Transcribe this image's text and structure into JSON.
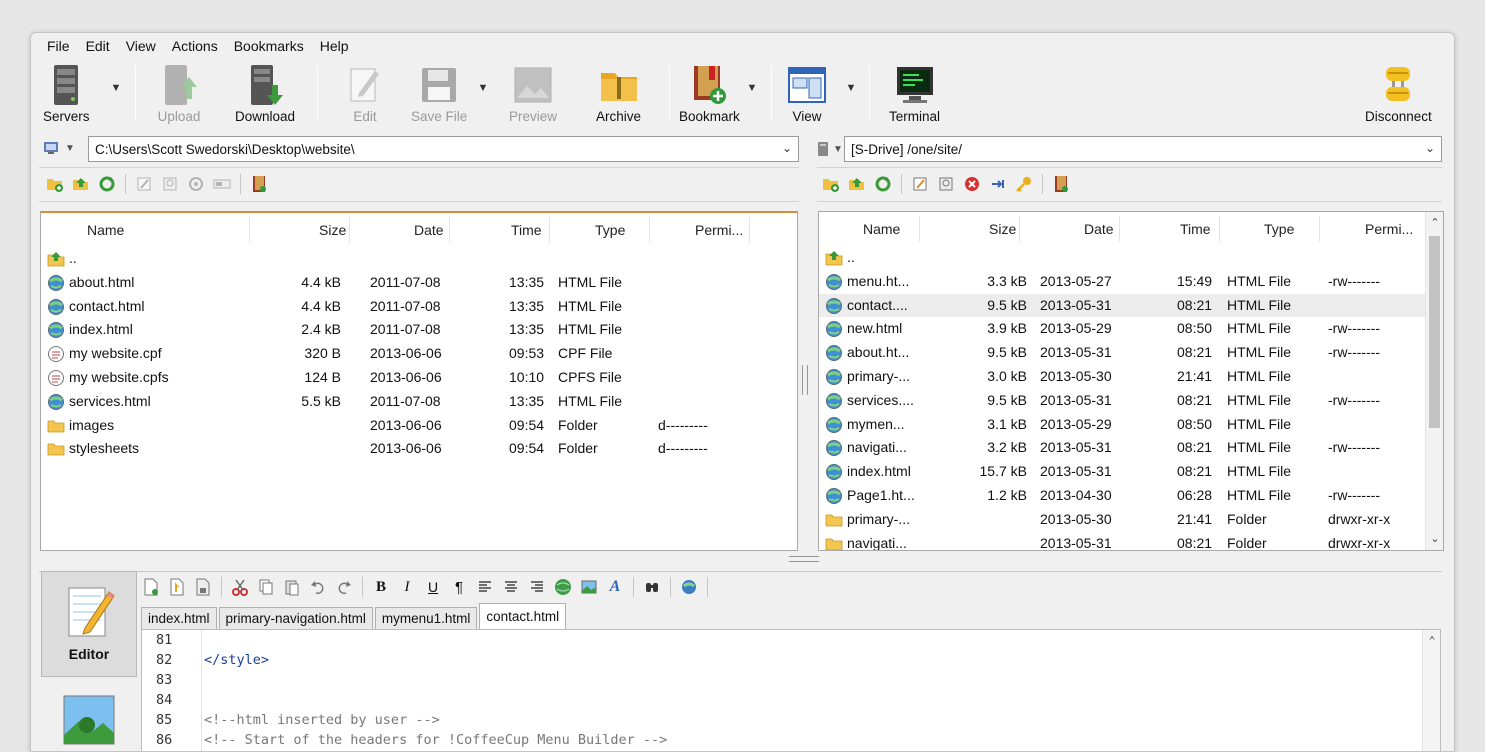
{
  "menu": [
    "File",
    "Edit",
    "View",
    "Actions",
    "Bookmarks",
    "Help"
  ],
  "toolbar": {
    "servers": "Servers",
    "upload": "Upload",
    "download": "Download",
    "edit": "Edit",
    "save_file": "Save File",
    "preview": "Preview",
    "archive": "Archive",
    "bookmark": "Bookmark",
    "view": "View",
    "terminal": "Terminal",
    "disconnect": "Disconnect"
  },
  "local": {
    "path": "C:\\Users\\Scott Swedorski\\Desktop\\website\\",
    "columns": [
      "Name",
      "Size",
      "Date",
      "Time",
      "Type",
      "Permi..."
    ],
    "parent": "..",
    "rows": [
      {
        "name": "about.html",
        "size": "4.4 kB",
        "date": "2011-07-08",
        "time": "13:35",
        "type": "HTML File",
        "perm": "",
        "icon": "html-file-icon"
      },
      {
        "name": "contact.html",
        "size": "4.4 kB",
        "date": "2011-07-08",
        "time": "13:35",
        "type": "HTML File",
        "perm": "",
        "icon": "html-file-icon"
      },
      {
        "name": "index.html",
        "size": "2.4 kB",
        "date": "2011-07-08",
        "time": "13:35",
        "type": "HTML File",
        "perm": "",
        "icon": "html-file-icon"
      },
      {
        "name": "my website.cpf",
        "size": "320 B",
        "date": "2013-06-06",
        "time": "09:53",
        "type": "CPF File",
        "perm": "",
        "icon": "doc-file-icon"
      },
      {
        "name": "my website.cpfs",
        "size": "124 B",
        "date": "2013-06-06",
        "time": "10:10",
        "type": "CPFS File",
        "perm": "",
        "icon": "doc-file-icon"
      },
      {
        "name": "services.html",
        "size": "5.5 kB",
        "date": "2011-07-08",
        "time": "13:35",
        "type": "HTML File",
        "perm": "",
        "icon": "html-file-icon"
      },
      {
        "name": "images",
        "size": "",
        "date": "2013-06-06",
        "time": "09:54",
        "type": "Folder",
        "perm": "d---------",
        "icon": "folder-icon"
      },
      {
        "name": "stylesheets",
        "size": "",
        "date": "2013-06-06",
        "time": "09:54",
        "type": "Folder",
        "perm": "d---------",
        "icon": "folder-icon"
      }
    ]
  },
  "remote": {
    "path": "[S-Drive] /one/site/",
    "columns": [
      "Name",
      "Size",
      "Date",
      "Time",
      "Type",
      "Permi..."
    ],
    "parent": "..",
    "rows": [
      {
        "name": "menu.ht...",
        "size": "3.3 kB",
        "date": "2013-05-27",
        "time": "15:49",
        "type": "HTML File",
        "perm": "-rw-------",
        "icon": "html-file-icon"
      },
      {
        "name": "contact....",
        "size": "9.5 kB",
        "date": "2013-05-31",
        "time": "08:21",
        "type": "HTML File",
        "perm": "",
        "icon": "html-file-icon"
      },
      {
        "name": "new.html",
        "size": "3.9 kB",
        "date": "2013-05-29",
        "time": "08:50",
        "type": "HTML File",
        "perm": "-rw-------",
        "icon": "html-file-icon"
      },
      {
        "name": "about.ht...",
        "size": "9.5 kB",
        "date": "2013-05-31",
        "time": "08:21",
        "type": "HTML File",
        "perm": "-rw-------",
        "icon": "html-file-icon"
      },
      {
        "name": "primary-...",
        "size": "3.0 kB",
        "date": "2013-05-30",
        "time": "21:41",
        "type": "HTML File",
        "perm": "",
        "icon": "html-file-icon"
      },
      {
        "name": "services....",
        "size": "9.5 kB",
        "date": "2013-05-31",
        "time": "08:21",
        "type": "HTML File",
        "perm": "-rw-------",
        "icon": "html-file-icon"
      },
      {
        "name": "mymen...",
        "size": "3.1 kB",
        "date": "2013-05-29",
        "time": "08:50",
        "type": "HTML File",
        "perm": "",
        "icon": "html-file-icon"
      },
      {
        "name": "navigati...",
        "size": "3.2 kB",
        "date": "2013-05-31",
        "time": "08:21",
        "type": "HTML File",
        "perm": "-rw-------",
        "icon": "html-file-icon"
      },
      {
        "name": "index.html",
        "size": "15.7 kB",
        "date": "2013-05-31",
        "time": "08:21",
        "type": "HTML File",
        "perm": "",
        "icon": "html-file-icon"
      },
      {
        "name": "Page1.ht...",
        "size": "1.2 kB",
        "date": "2013-04-30",
        "time": "06:28",
        "type": "HTML File",
        "perm": "-rw-------",
        "icon": "html-file-icon"
      },
      {
        "name": "primary-...",
        "size": "",
        "date": "2013-05-30",
        "time": "21:41",
        "type": "Folder",
        "perm": "drwxr-xr-x",
        "icon": "folder-icon"
      },
      {
        "name": "navigati...",
        "size": "",
        "date": "2013-05-31",
        "time": "08:21",
        "type": "Folder",
        "perm": "drwxr-xr-x",
        "icon": "folder-icon"
      }
    ]
  },
  "editor": {
    "side_label": "Editor",
    "tabs": [
      "index.html",
      "primary-navigation.html",
      "mymenu1.html",
      "contact.html"
    ],
    "active_tab": "contact.html",
    "lines": [
      {
        "num": "81",
        "text": ""
      },
      {
        "num": "82",
        "text": "</style>"
      },
      {
        "num": "83",
        "text": ""
      },
      {
        "num": "84",
        "text": ""
      },
      {
        "num": "85",
        "text": "<!--html inserted by user -->"
      },
      {
        "num": "86",
        "text": "<!-- Start of the headers for !CoffeeCup Menu Builder -->"
      }
    ]
  },
  "colors": {
    "accent_orange": "#d88c3e",
    "code_tag": "#1a3f9a",
    "code_comment": "#777777"
  }
}
